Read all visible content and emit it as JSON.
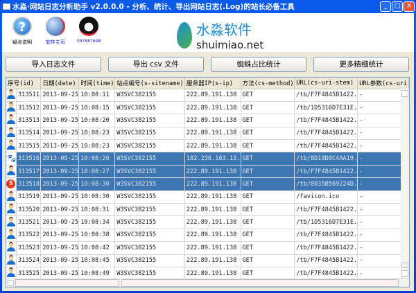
{
  "window": {
    "title": "水淼·网站日志分析助手 v2.0.0.0 - 分析、统计、导出网站日志(.Log)的站长必备工具",
    "minimize": "_",
    "maximize": "□",
    "close": "X",
    "close_color": "#e2553a"
  },
  "header": {
    "links": [
      {
        "label": "疑点说明",
        "icon": "help-icon"
      },
      {
        "label": "软件主页",
        "icon": "globe-icon"
      },
      {
        "label": "097687648",
        "icon": "qq-penguin-icon"
      }
    ],
    "logo_cn": "水淼软件",
    "logo_en": "shuimiao.net"
  },
  "toolbar": {
    "import": "导入日志文件",
    "export": "导出 csv 文件",
    "spider": "蜘蛛占比统计",
    "more": "更多精细统计"
  },
  "table": {
    "columns": [
      "序号(id)",
      "日期(date)",
      "时间(time)",
      "站点编号(s-sitename)",
      "服务器IP(s-ip)",
      "方法(cs-method)",
      "URL(cs-uri-stem)",
      "URL参数(cs-uri"
    ],
    "selected_color": "#3d76b0",
    "rows": [
      {
        "icon": "user-icon",
        "id": "313511",
        "date": "2013-09-25",
        "time": "10:08:11",
        "site": "W3SVC382155",
        "ip": "222.89.191.138",
        "method": "GET",
        "url": "/tb/F7F4845B1422.",
        "query": "-"
      },
      {
        "icon": "user-icon",
        "id": "313512",
        "date": "2013-09-25",
        "time": "10:08:15",
        "site": "W3SVC382155",
        "ip": "222.89.191.138",
        "method": "GET",
        "url": "/tb/1D5316D7E31E.",
        "query": "-"
      },
      {
        "icon": "user-icon",
        "id": "313513",
        "date": "2013-09-25",
        "time": "10:08:20",
        "site": "W3SVC382155",
        "ip": "222.89.191.138",
        "method": "GET",
        "url": "/tb/F7F4845B1422.",
        "query": "-"
      },
      {
        "icon": "user-icon",
        "id": "313514",
        "date": "2013-09-25",
        "time": "10:08:23",
        "site": "W3SVC382155",
        "ip": "222.89.191.138",
        "method": "GET",
        "url": "/tb/F7F4845B1422.",
        "query": "-"
      },
      {
        "icon": "user-icon",
        "id": "313515",
        "date": "2013-09-25",
        "time": "10:08:23",
        "site": "W3SVC382155",
        "ip": "222.89.191.138",
        "method": "GET",
        "url": "/tb/F7F4845B1422.",
        "query": "-"
      },
      {
        "icon": "baidu-icon",
        "selected": true,
        "id": "313516",
        "date": "2013-09-25",
        "time": "10:08:26",
        "site": "W3SVC382155",
        "ip": "182.236.163.13.",
        "method": "GET",
        "url": "/tb/8D18D8C4AA19.",
        "query": "-"
      },
      {
        "icon": "user-icon",
        "selected": true,
        "id": "313517",
        "date": "2013-09-25",
        "time": "10:08:27",
        "site": "W3SVC382155",
        "ip": "222.89.191.138",
        "method": "GET",
        "url": "/tb/F7F4845B1422.",
        "query": "-"
      },
      {
        "icon": "sogou-icon",
        "selected": true,
        "id": "313518",
        "date": "2013-09-25",
        "time": "10:08:30",
        "site": "W3SVC382155",
        "ip": "222.89.191.138",
        "method": "GET",
        "url": "/tb/0035B569224D.",
        "query": "-"
      },
      {
        "icon": "user-icon",
        "id": "313519",
        "date": "2013-09-25",
        "time": "10:08:30",
        "site": "W3SVC382155",
        "ip": "222.89.191.138",
        "method": "GET",
        "url": "/favicon.ico",
        "query": "-"
      },
      {
        "icon": "user-icon",
        "id": "313520",
        "date": "2013-09-25",
        "time": "10:08:31",
        "site": "W3SVC382155",
        "ip": "222.89.191.138",
        "method": "GET",
        "url": "/tb/F7F4845B1422.",
        "query": "-"
      },
      {
        "icon": "user-icon",
        "id": "313521",
        "date": "2013-09-25",
        "time": "10:08:34",
        "site": "W3SVC382155",
        "ip": "222.89.191.138",
        "method": "GET",
        "url": "/tb/1D5316D7E31E.",
        "query": "-"
      },
      {
        "icon": "user-icon",
        "id": "313522",
        "date": "2013-09-25",
        "time": "10:08:38",
        "site": "W3SVC382155",
        "ip": "222.89.191.138",
        "method": "GET",
        "url": "/tb/F7F4845B1422.",
        "query": "-"
      },
      {
        "icon": "user-icon",
        "id": "313523",
        "date": "2013-09-25",
        "time": "10:08:42",
        "site": "W3SVC382155",
        "ip": "222.89.191.138",
        "method": "GET",
        "url": "/tb/F7F4845B1422.",
        "query": "-"
      },
      {
        "icon": "user-icon",
        "id": "313524",
        "date": "2013-09-25",
        "time": "10:08:45",
        "site": "W3SVC382155",
        "ip": "222.89.191.138",
        "method": "GET",
        "url": "/tb/F7F4845B1422.",
        "query": "-"
      },
      {
        "icon": "user-icon",
        "id": "313525",
        "date": "2013-09-25",
        "time": "10:08:49",
        "site": "W3SVC382155",
        "ip": "222.89.191.138",
        "method": "GET",
        "url": "/tb/F7F4845B1422.",
        "query": "-"
      }
    ]
  }
}
